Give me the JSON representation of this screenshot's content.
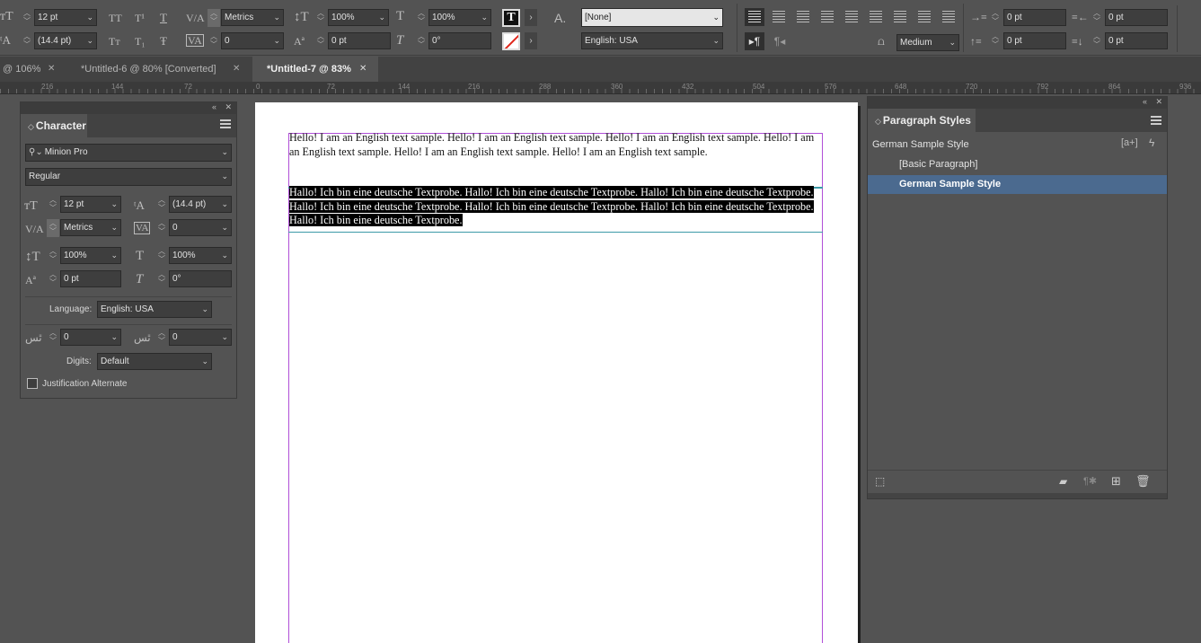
{
  "control": {
    "font_size": "12 pt",
    "leading": "(14.4 pt)",
    "kerning": "Metrics",
    "tracking": "0",
    "vscale": "100%",
    "hscale": "100%",
    "baseline": "0 pt",
    "skew": "0°",
    "char_style": "[None]",
    "language": "English: USA",
    "indent_left": "0 pt",
    "indent_right": "0 pt",
    "space_before": "0 pt",
    "space_after": "0 pt",
    "bullet_weight": "Medium",
    "caps_all": "TT",
    "caps_super": "T¹",
    "caps_under": "T",
    "small_caps": "Tт",
    "caps_sub": "T₁",
    "caps_strike": "Ŧ"
  },
  "tabs": [
    {
      "label": "@ 106%"
    },
    {
      "label": "*Untitled-6 @ 80% [Converted]"
    },
    {
      "label": "*Untitled-7 @ 83%"
    }
  ],
  "close_glyph": "✕",
  "ruler": {
    "ticks": [
      "216",
      "144",
      "72",
      "0",
      "72",
      "144",
      "216",
      "288",
      "360",
      "432",
      "504",
      "576",
      "648",
      "720",
      "792",
      "864",
      "936"
    ]
  },
  "character_panel": {
    "title": "Character",
    "font_family": "Minion Pro",
    "font_style": "Regular",
    "font_size": "12 pt",
    "leading": "(14.4 pt)",
    "kerning": "Metrics",
    "tracking": "0",
    "vscale": "100%",
    "hscale": "100%",
    "baseline": "0 pt",
    "skew": "0°",
    "language_label": "Language:",
    "language": "English: USA",
    "kashida1": "0",
    "kashida2": "0",
    "digits_label": "Digits:",
    "digits": "Default",
    "justification_label": "Justification Alternate"
  },
  "paragraph_panel": {
    "title": "Paragraph Styles",
    "current": "German Sample Style",
    "items": [
      {
        "label": "[Basic Paragraph]"
      },
      {
        "label": "German Sample Style"
      }
    ]
  },
  "document": {
    "english": "Hello! I am an English text sample. Hello! I am an English text sample. Hello! I am an English text sample. Hello! I am an English text sample. Hello! I am an English text sample. Hello! I am an English text sample.",
    "german": "Hallo! Ich bin eine deutsche Textprobe. Hallo! Ich bin eine deutsche Textprobe. Hallo! Ich bin eine deutsche Textprobe. Hallo! Ich bin eine deutsche Textprobe. Hallo! Ich bin eine deutsche Textprobe. Hallo! Ich bin eine deutsche Textprobe. Hallo! Ich bin eine deutsche Textprobe."
  },
  "colors": {
    "accent_selected": "#4b6a8f",
    "guide_magenta": "#b04fd8",
    "guide_cyan": "#3d9aa8"
  }
}
